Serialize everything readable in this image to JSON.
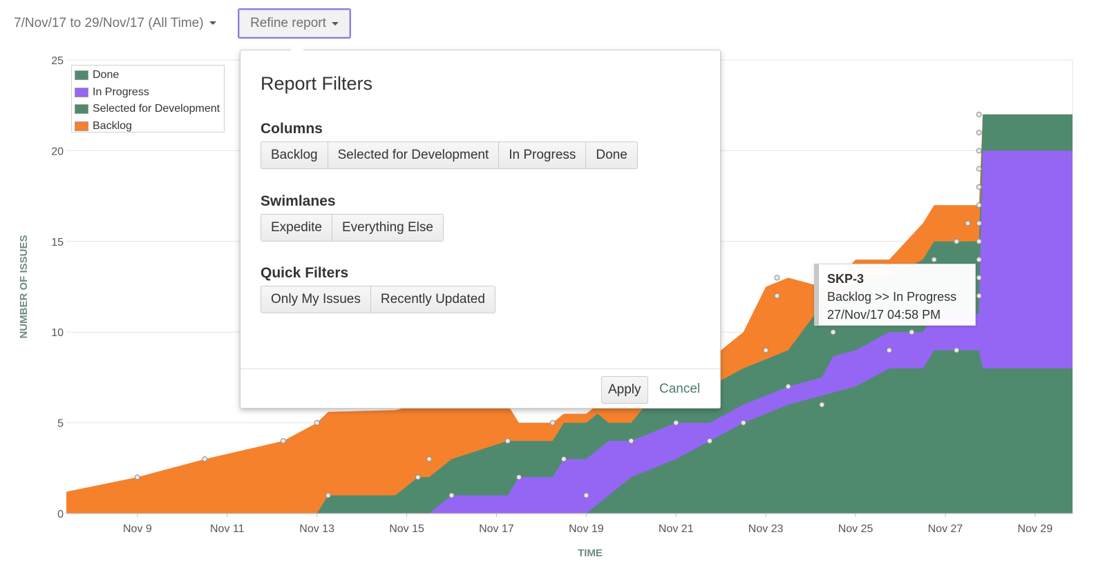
{
  "toolbar": {
    "date_range": "7/Nov/17 to 29/Nov/17 (All Time)",
    "refine_label": "Refine report"
  },
  "popup": {
    "title": "Report Filters",
    "columns": {
      "heading": "Columns",
      "options": [
        "Backlog",
        "Selected for Development",
        "In Progress",
        "Done"
      ]
    },
    "swimlanes": {
      "heading": "Swimlanes",
      "options": [
        "Expedite",
        "Everything Else"
      ]
    },
    "quick_filters": {
      "heading": "Quick Filters",
      "options": [
        "Only My Issues",
        "Recently Updated"
      ]
    },
    "apply_label": "Apply",
    "cancel_label": "Cancel"
  },
  "tooltip": {
    "key": "SKP-3",
    "transition": "Backlog >> In Progress",
    "timestamp": "27/Nov/17 04:58 PM"
  },
  "legend": [
    {
      "label": "Done",
      "color": "#4f8a6f"
    },
    {
      "label": "In Progress",
      "color": "#9566f4"
    },
    {
      "label": "Selected for Development",
      "color": "#4f8a6f"
    },
    {
      "label": "Backlog",
      "color": "#f5812c"
    }
  ],
  "chart_data": {
    "type": "area",
    "stacked": true,
    "xlabel": "TIME",
    "ylabel": "NUMBER OF ISSUES",
    "x_ticks": [
      "Nov 9",
      "Nov 11",
      "Nov 13",
      "Nov 15",
      "Nov 17",
      "Nov 19",
      "Nov 21",
      "Nov 23",
      "Nov 25",
      "Nov 27",
      "Nov 29"
    ],
    "y_ticks": [
      0,
      5,
      10,
      15,
      20,
      25
    ],
    "ylim": [
      0,
      25
    ],
    "xlim": [
      "2017-11-07 10:00",
      "2017-11-29 20:00"
    ],
    "grid": true,
    "legend_position": "top-left",
    "series": [
      {
        "name": "Done",
        "color": "#4f8a6f",
        "points": [
          [
            "2017-11-07 10:00",
            0
          ],
          [
            "2017-11-19 00:00",
            0
          ],
          [
            "2017-11-19 12:00",
            1
          ],
          [
            "2017-11-20 00:00",
            2
          ],
          [
            "2017-11-21 00:00",
            3
          ],
          [
            "2017-11-21 18:00",
            4
          ],
          [
            "2017-11-22 12:00",
            5
          ],
          [
            "2017-11-23 12:00",
            6
          ],
          [
            "2017-11-25 00:00",
            7
          ],
          [
            "2017-11-25 18:00",
            8
          ],
          [
            "2017-11-26 12:00",
            8
          ],
          [
            "2017-11-26 18:00",
            9
          ],
          [
            "2017-11-27 18:00",
            9
          ],
          [
            "2017-11-27 20:00",
            8
          ],
          [
            "2017-11-29 20:00",
            8
          ]
        ]
      },
      {
        "name": "In Progress",
        "color": "#9566f4",
        "points": [
          [
            "2017-11-07 10:00",
            0
          ],
          [
            "2017-11-15 12:00",
            0
          ],
          [
            "2017-11-16 00:00",
            1
          ],
          [
            "2017-11-17 06:00",
            1
          ],
          [
            "2017-11-17 12:00",
            2
          ],
          [
            "2017-11-18 06:00",
            2
          ],
          [
            "2017-11-18 12:00",
            3
          ],
          [
            "2017-11-19 06:00",
            3
          ],
          [
            "2017-11-19 12:00",
            3
          ],
          [
            "2017-11-20 00:00",
            2
          ],
          [
            "2017-11-20 12:00",
            2
          ],
          [
            "2017-11-21 00:00",
            2
          ],
          [
            "2017-11-21 18:00",
            1
          ],
          [
            "2017-11-22 12:00",
            1
          ],
          [
            "2017-11-23 00:00",
            1
          ],
          [
            "2017-11-23 12:00",
            1
          ],
          [
            "2017-11-24 06:00",
            1
          ],
          [
            "2017-11-24 12:00",
            2
          ],
          [
            "2017-11-25 00:00",
            2
          ],
          [
            "2017-11-25 18:00",
            2
          ],
          [
            "2017-11-26 12:00",
            2
          ],
          [
            "2017-11-27 18:00",
            2
          ],
          [
            "2017-11-27 20:00",
            12
          ],
          [
            "2017-11-29 20:00",
            12
          ]
        ]
      },
      {
        "name": "Selected for Development",
        "color": "#4f8a6f",
        "points": [
          [
            "2017-11-07 10:00",
            0
          ],
          [
            "2017-11-13 00:00",
            0
          ],
          [
            "2017-11-13 06:00",
            1
          ],
          [
            "2017-11-14 18:00",
            1
          ],
          [
            "2017-11-15 06:00",
            2
          ],
          [
            "2017-11-15 12:00",
            2
          ],
          [
            "2017-11-16 00:00",
            2
          ],
          [
            "2017-11-17 06:00",
            3
          ],
          [
            "2017-11-17 12:00",
            2
          ],
          [
            "2017-11-18 06:00",
            2
          ],
          [
            "2017-11-18 12:00",
            2
          ],
          [
            "2017-11-19 06:00",
            2
          ],
          [
            "2017-11-19 12:00",
            1
          ],
          [
            "2017-11-20 00:00",
            1
          ],
          [
            "2017-11-20 12:00",
            2
          ],
          [
            "2017-11-21 00:00",
            2
          ],
          [
            "2017-11-21 18:00",
            2
          ],
          [
            "2017-11-22 12:00",
            2
          ],
          [
            "2017-11-23 00:00",
            2
          ],
          [
            "2017-11-23 12:00",
            2
          ],
          [
            "2017-11-24 06:00",
            4
          ],
          [
            "2017-11-24 12:00",
            3
          ],
          [
            "2017-11-25 00:00",
            4
          ],
          [
            "2017-11-25 18:00",
            3
          ],
          [
            "2017-11-26 12:00",
            4
          ],
          [
            "2017-11-27 18:00",
            4
          ],
          [
            "2017-11-27 20:00",
            2
          ],
          [
            "2017-11-29 20:00",
            2
          ]
        ]
      },
      {
        "name": "Backlog",
        "color": "#f5812c",
        "points": [
          [
            "2017-11-07 10:00",
            1.2
          ],
          [
            "2017-11-09 00:00",
            2
          ],
          [
            "2017-11-10 12:00",
            3
          ],
          [
            "2017-11-12 06:00",
            4
          ],
          [
            "2017-11-13 00:00",
            5
          ],
          [
            "2017-11-13 06:00",
            4.6
          ],
          [
            "2017-11-14 18:00",
            4.7
          ],
          [
            "2017-11-15 06:00",
            4
          ],
          [
            "2017-11-15 12:00",
            4
          ],
          [
            "2017-11-16 00:00",
            3
          ],
          [
            "2017-11-17 06:00",
            2
          ],
          [
            "2017-11-17 12:00",
            1
          ],
          [
            "2017-11-18 06:00",
            1
          ],
          [
            "2017-11-18 12:00",
            0.5
          ],
          [
            "2017-11-19 06:00",
            0.5
          ],
          [
            "2017-11-19 12:00",
            1
          ],
          [
            "2017-11-20 00:00",
            1
          ],
          [
            "2017-11-20 12:00",
            1
          ],
          [
            "2017-11-21 00:00",
            1
          ],
          [
            "2017-11-21 18:00",
            1.5
          ],
          [
            "2017-11-22 12:00",
            2
          ],
          [
            "2017-11-23 00:00",
            4
          ],
          [
            "2017-11-23 12:00",
            4
          ],
          [
            "2017-11-24 06:00",
            1
          ],
          [
            "2017-11-24 12:00",
            1
          ],
          [
            "2017-11-25 00:00",
            1
          ],
          [
            "2017-11-25 18:00",
            1
          ],
          [
            "2017-11-26 12:00",
            2
          ],
          [
            "2017-11-27 18:00",
            2
          ],
          [
            "2017-11-27 20:00",
            0
          ],
          [
            "2017-11-29 20:00",
            0
          ]
        ]
      }
    ],
    "markers": [
      [
        "2017-11-09 00:00",
        2
      ],
      [
        "2017-11-10 12:00",
        3
      ],
      [
        "2017-11-12 06:00",
        4
      ],
      [
        "2017-11-13 00:00",
        5
      ],
      [
        "2017-11-13 06:00",
        1
      ],
      [
        "2017-11-15 06:00",
        2
      ],
      [
        "2017-11-15 12:00",
        3
      ],
      [
        "2017-11-16 00:00",
        1
      ],
      [
        "2017-11-17 06:00",
        4
      ],
      [
        "2017-11-17 12:00",
        2
      ],
      [
        "2017-11-18 06:00",
        5
      ],
      [
        "2017-11-18 12:00",
        3
      ],
      [
        "2017-11-19 00:00",
        1
      ],
      [
        "2017-11-20 00:00",
        4
      ],
      [
        "2017-11-21 00:00",
        5
      ],
      [
        "2017-11-21 18:00",
        4
      ],
      [
        "2017-11-22 12:00",
        5
      ],
      [
        "2017-11-23 00:00",
        9
      ],
      [
        "2017-11-23 06:00",
        12
      ],
      [
        "2017-11-23 06:00",
        13
      ],
      [
        "2017-11-23 12:00",
        7
      ],
      [
        "2017-11-24 06:00",
        6
      ],
      [
        "2017-11-24 12:00",
        10
      ],
      [
        "2017-11-24 18:00",
        11
      ],
      [
        "2017-11-25 00:00",
        12
      ],
      [
        "2017-11-25 18:00",
        9
      ],
      [
        "2017-11-26 06:00",
        10
      ],
      [
        "2017-11-26 18:00",
        14
      ],
      [
        "2017-11-27 06:00",
        9
      ],
      [
        "2017-11-27 06:00",
        15
      ],
      [
        "2017-11-27 12:00",
        16
      ],
      [
        "2017-11-27 18:00",
        12
      ],
      [
        "2017-11-27 18:00",
        13
      ],
      [
        "2017-11-27 18:00",
        14
      ],
      [
        "2017-11-27 18:00",
        15
      ],
      [
        "2017-11-27 18:00",
        16
      ],
      [
        "2017-11-27 18:00",
        17
      ],
      [
        "2017-11-27 18:00",
        18
      ],
      [
        "2017-11-27 18:00",
        19
      ],
      [
        "2017-11-27 18:00",
        20
      ],
      [
        "2017-11-27 18:00",
        21
      ],
      [
        "2017-11-27 18:00",
        22
      ]
    ]
  }
}
